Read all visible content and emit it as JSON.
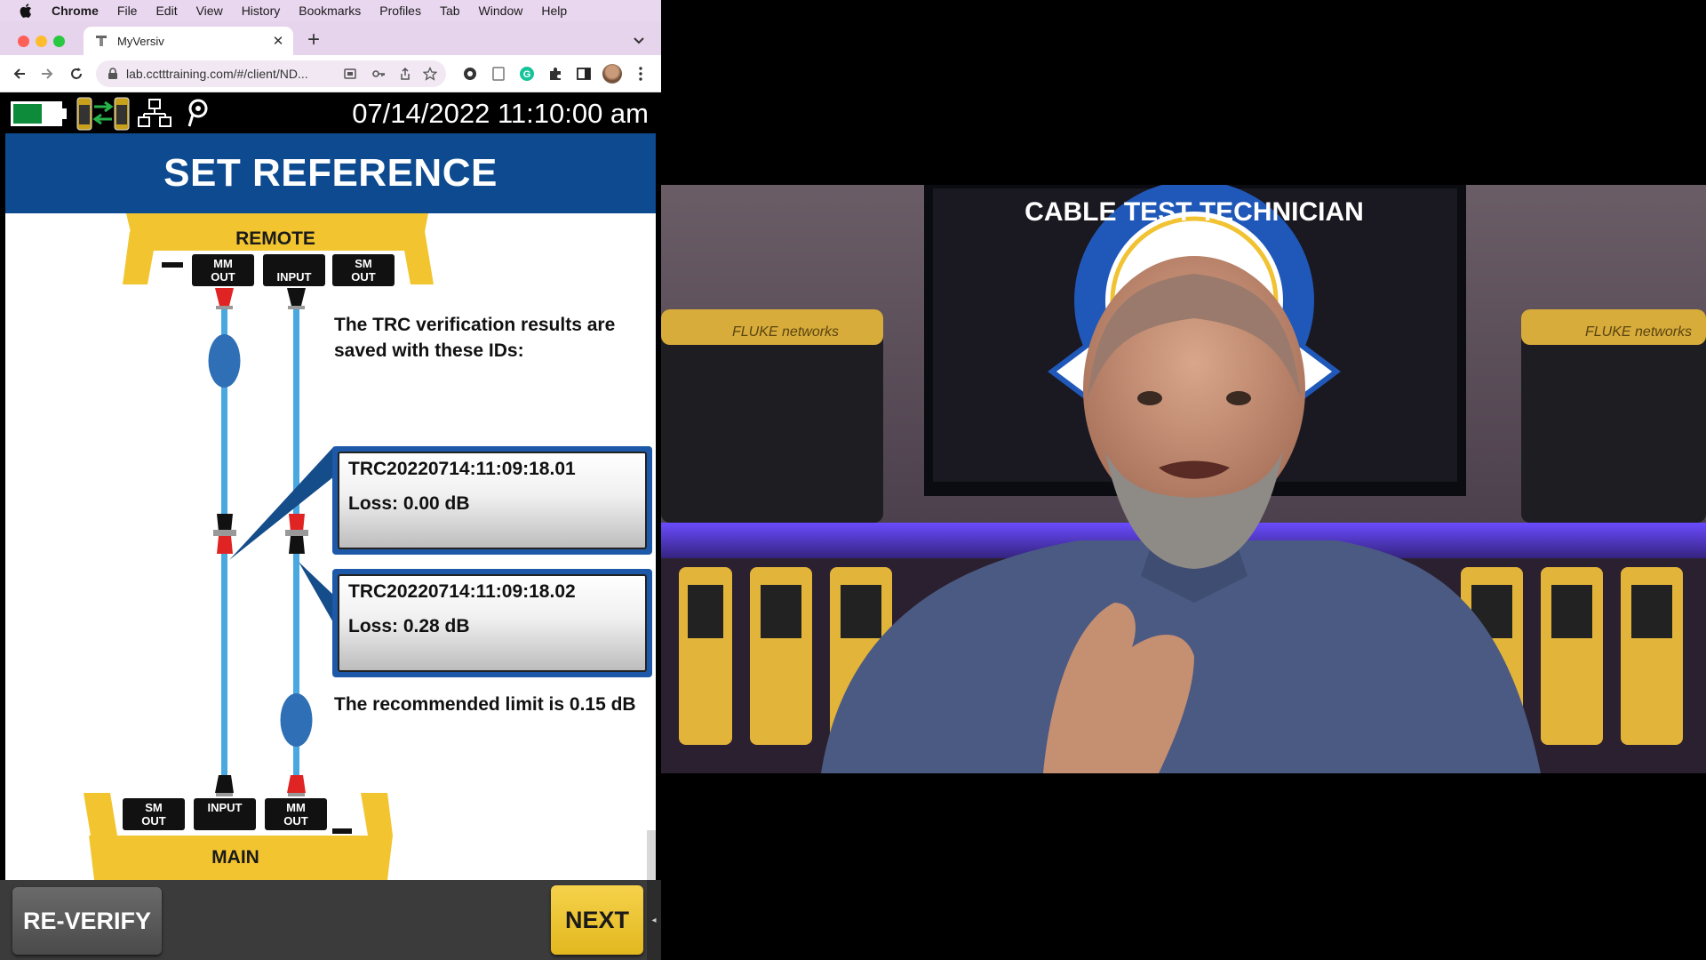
{
  "menubar": {
    "app": "Chrome",
    "items": [
      "File",
      "Edit",
      "View",
      "History",
      "Bookmarks",
      "Profiles",
      "Tab",
      "Window",
      "Help"
    ]
  },
  "browser": {
    "tab_title": "MyVersiv",
    "url": "lab.cctttraining.com/#/client/ND..."
  },
  "device": {
    "datetime": "07/14/2022 11:10:00 am",
    "title": "SET REFERENCE",
    "remote_label": "REMOTE",
    "main_label": "MAIN",
    "remote_ports": [
      "MM\nOUT",
      "INPUT",
      "SM\nOUT"
    ],
    "main_ports": [
      "SM\nOUT",
      "INPUT",
      "MM\nOUT"
    ],
    "message_top": "The TRC verification results are saved with these IDs:",
    "results": [
      {
        "id": "TRC20220714:11:09:18.01",
        "loss": "Loss: 0.00 dB"
      },
      {
        "id": "TRC20220714:11:09:18.02",
        "loss": "Loss: 0.28 dB"
      }
    ],
    "message_bottom": "The recommended limit is 0.15 dB",
    "buttons": {
      "reverify": "RE-VERIFY",
      "next": "NEXT"
    }
  },
  "video": {
    "banner_text": "CABLE TEST TECHNICIAN",
    "case_brand": "FLUKE networks"
  },
  "colors": {
    "menubar_bg": "#e9d7ef",
    "title_blue": "#0d4a8f",
    "fiber_blue": "#4aa8e0",
    "unit_yellow": "#f2c530",
    "next_yellow": "#f0c93a"
  }
}
